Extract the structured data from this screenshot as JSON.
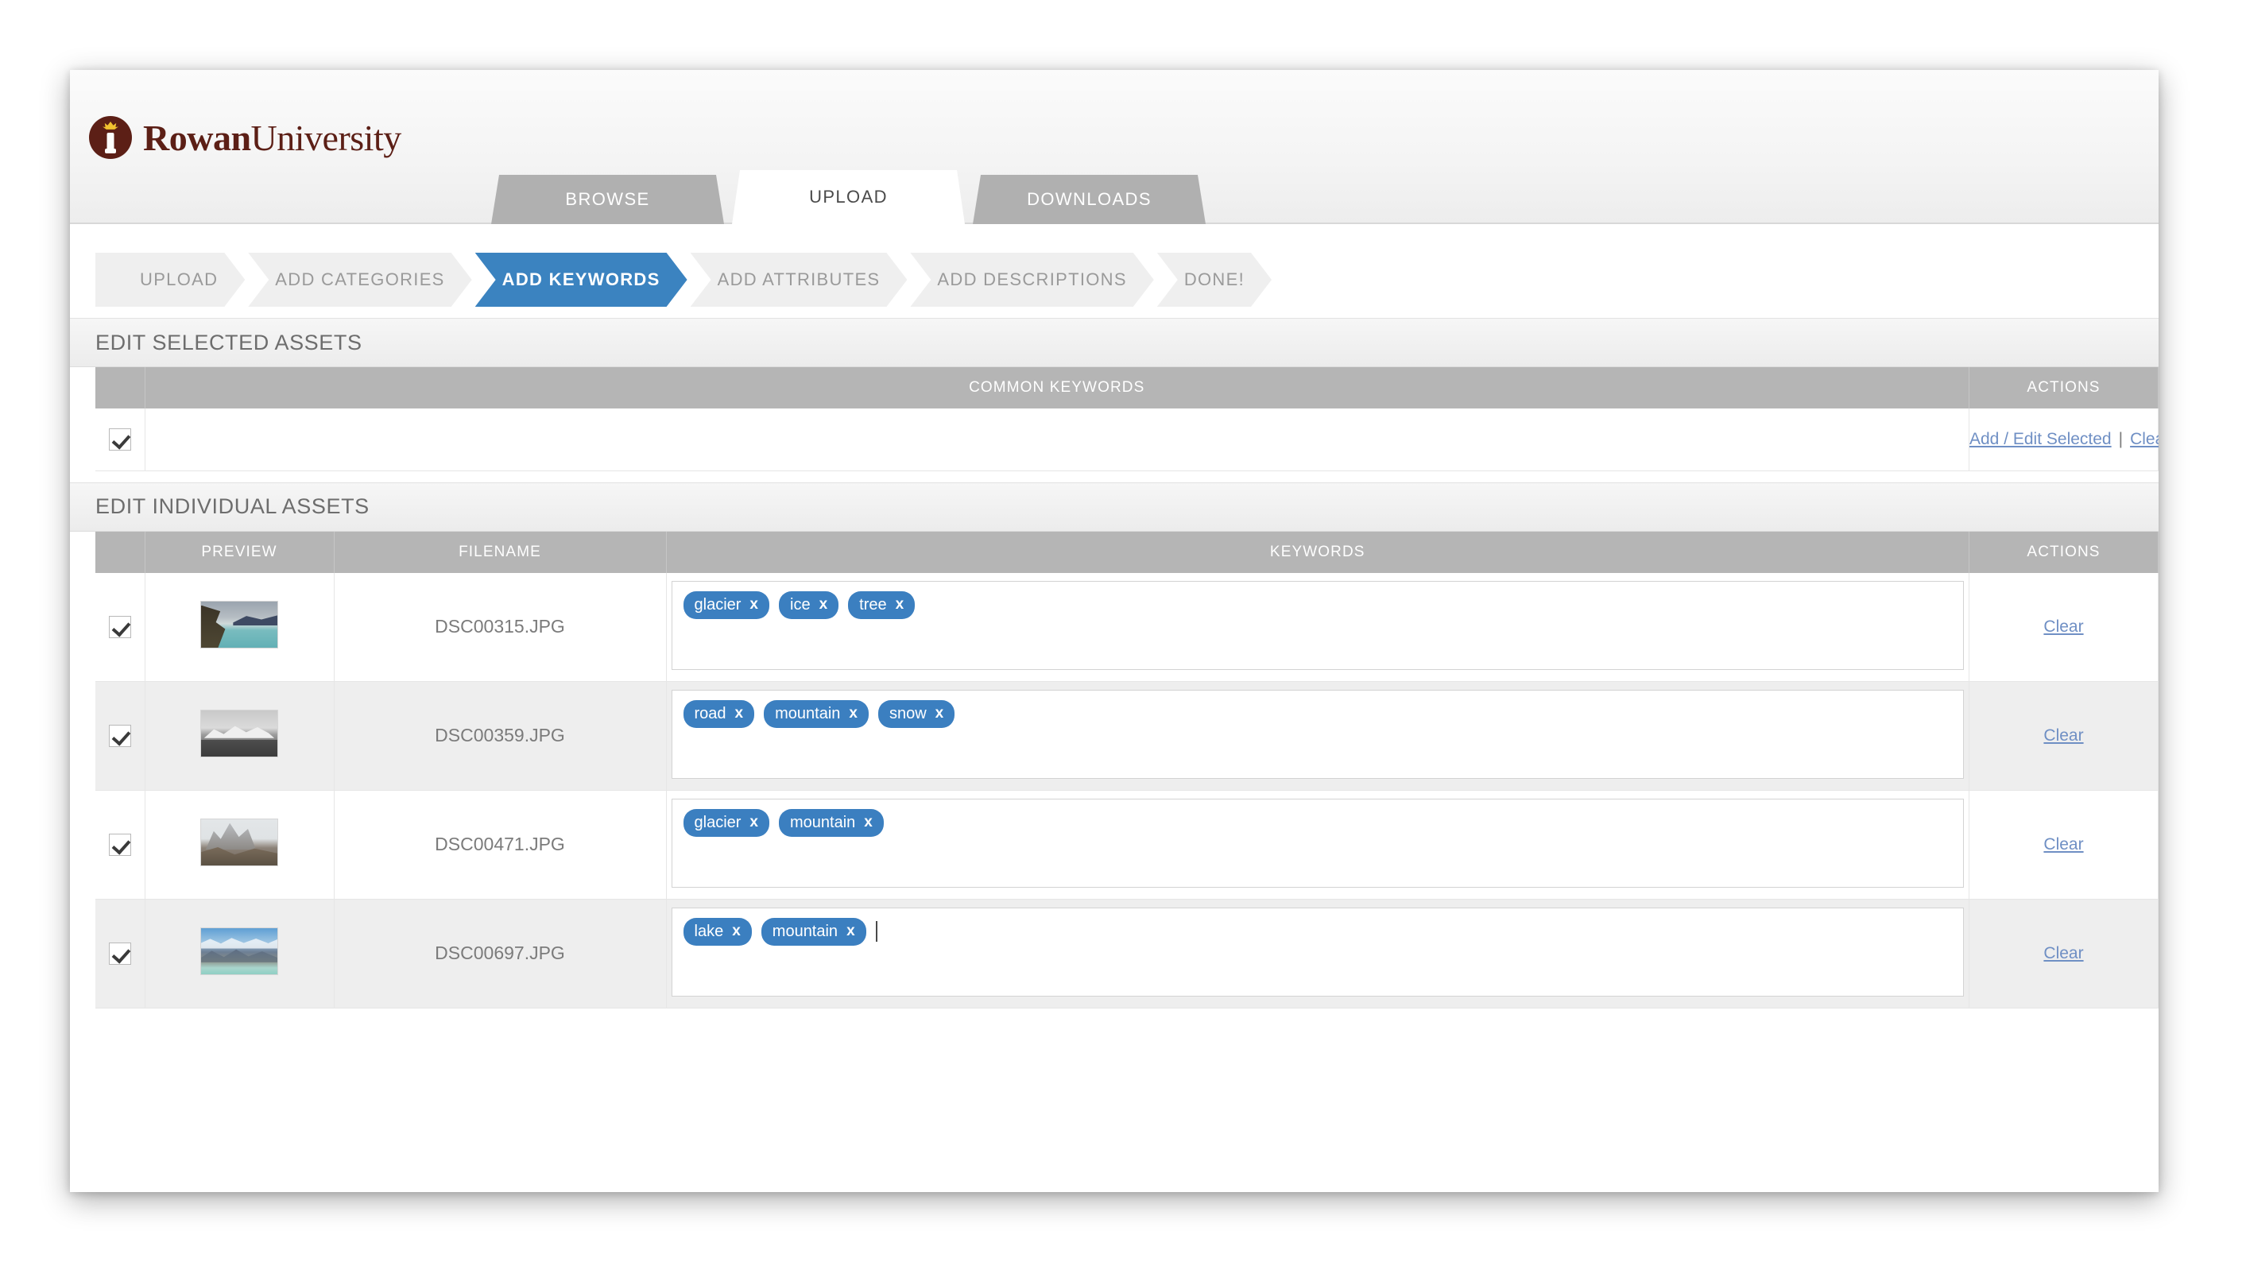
{
  "brand": {
    "logo_text_bold": "Rowan",
    "logo_text_light": "University",
    "logo_icon": "torch-icon",
    "logo_color": "#5c1f16",
    "flame_color": "#f2c230"
  },
  "tabs": [
    {
      "label": "BROWSE",
      "active": false
    },
    {
      "label": "UPLOAD",
      "active": true
    },
    {
      "label": "DOWNLOADS",
      "active": false
    }
  ],
  "wizard": {
    "active_color": "#3b83c0",
    "steps": [
      {
        "label": "UPLOAD",
        "active": false
      },
      {
        "label": "ADD CATEGORIES",
        "active": false
      },
      {
        "label": "ADD KEYWORDS",
        "active": true
      },
      {
        "label": "ADD ATTRIBUTES",
        "active": false
      },
      {
        "label": "ADD DESCRIPTIONS",
        "active": false
      },
      {
        "label": "DONE!",
        "active": false
      }
    ]
  },
  "selected_section": {
    "title": "EDIT SELECTED ASSETS",
    "headers": {
      "common_keywords": "COMMON KEYWORDS",
      "actions": "ACTIONS"
    },
    "row": {
      "checked": true,
      "keywords": [],
      "actions": {
        "add_edit": "Add / Edit Selected",
        "separator": "|",
        "clear": "Clear"
      }
    }
  },
  "individual_section": {
    "title": "EDIT INDIVIDUAL ASSETS",
    "headers": {
      "preview": "PREVIEW",
      "filename": "FILENAME",
      "keywords": "KEYWORDS",
      "actions": "ACTIONS"
    },
    "clear_label": "Clear",
    "pill_color": "#3b7fc0",
    "remove_glyph": "x",
    "rows": [
      {
        "checked": true,
        "filename": "DSC00315.JPG",
        "thumbnail": "glacier-lake-thumbnail",
        "keywords": [
          "glacier",
          "ice",
          "tree"
        ],
        "focused": false,
        "clear": "Clear"
      },
      {
        "checked": true,
        "filename": "DSC00359.JPG",
        "thumbnail": "bw-mountain-range-thumbnail",
        "keywords": [
          "road",
          "mountain",
          "snow"
        ],
        "focused": false,
        "clear": "Clear"
      },
      {
        "checked": true,
        "filename": "DSC00471.JPG",
        "thumbnail": "rocky-peaks-thumbnail",
        "keywords": [
          "glacier",
          "mountain"
        ],
        "focused": false,
        "clear": "Clear"
      },
      {
        "checked": true,
        "filename": "DSC00697.JPG",
        "thumbnail": "blue-mountains-lake-thumbnail",
        "keywords": [
          "lake",
          "mountain"
        ],
        "focused": true,
        "clear": "Clear"
      }
    ]
  }
}
